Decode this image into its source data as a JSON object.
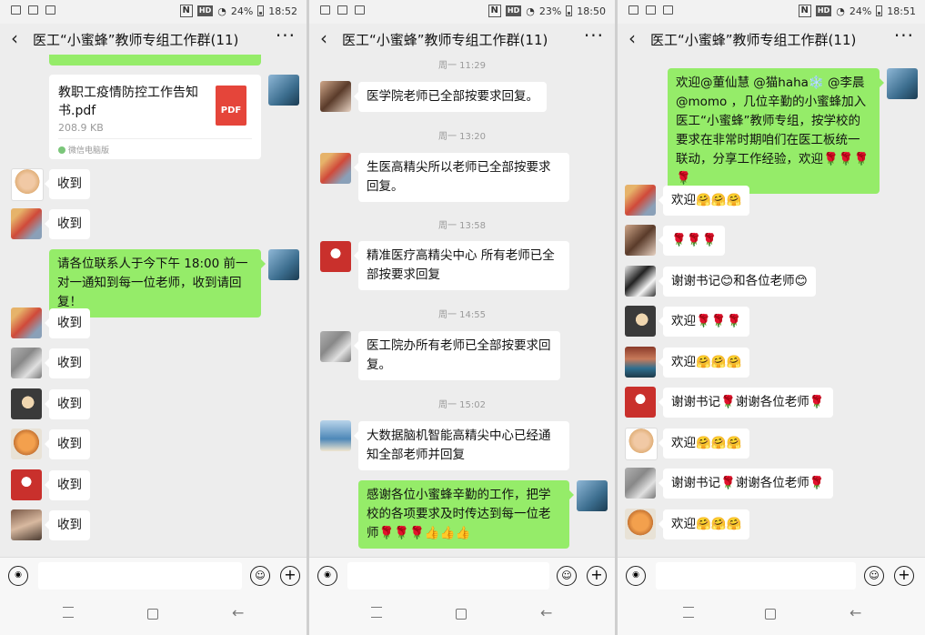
{
  "panels": [
    {
      "status": {
        "battery": "24%",
        "time": "18:52"
      },
      "title": "医工“小蜜蜂”教师专组工作群(11)",
      "file": {
        "name": "教职工疫情防控工作告知书.pdf",
        "size": "208.9 KB",
        "source": "微信电脑版",
        "icon_label": "PDF"
      },
      "messages": [
        {
          "text": "收到"
        },
        {
          "text": "收到"
        },
        {
          "text": "请各位联系人于今下午 18:00 前一对一通知到每一位老师，收到请回复！"
        },
        {
          "text": "收到"
        },
        {
          "text": "收到"
        },
        {
          "text": "收到"
        },
        {
          "text": "收到"
        },
        {
          "text": "收到"
        },
        {
          "text": "收到"
        }
      ]
    },
    {
      "status": {
        "battery": "23%",
        "time": "18:50"
      },
      "title": "医工“小蜜蜂”教师专组工作群(11)",
      "timestamps": [
        "周一 11:29",
        "周一 13:20",
        "周一 13:58",
        "周一 14:55",
        "周一 15:02"
      ],
      "messages": [
        {
          "text": "医学院老师已全部按要求回复。"
        },
        {
          "text": "生医高精尖所以老师已全部按要求回复。"
        },
        {
          "text": "精准医疗高精尖中心 所有老师已全部按要求回复"
        },
        {
          "text": "医工院办所有老师已全部按要求回复。"
        },
        {
          "text": "大数据脑机智能高精尖中心已经通知全部老师并回复"
        },
        {
          "text": "感谢各位小蜜蜂辛勤的工作，把学校的各项要求及时传达到每一位老师🌹🌹🌹👍👍👍"
        }
      ]
    },
    {
      "status": {
        "battery": "24%",
        "time": "18:51"
      },
      "title": "医工“小蜜蜂”教师专组工作群(11)",
      "messages": [
        {
          "text": "欢迎@董仙慧 @猫haha❄️ @李晨 @momo ，几位辛勤的小蜜蜂加入医工“小蜜蜂”教师专组，按学校的要求在非常时期咱们在医工板统一联动，分享工作经验，欢迎🌹🌹🌹🌹"
        },
        {
          "text": "欢迎🤗🤗🤗"
        },
        {
          "text": "🌹🌹🌹"
        },
        {
          "text": "谢谢书记😊和各位老师😊"
        },
        {
          "text": "欢迎🌹🌹🌹"
        },
        {
          "text": "欢迎🤗🤗🤗"
        },
        {
          "text": "谢谢书记🌹谢谢各位老师🌹"
        },
        {
          "text": "欢迎🤗🤗🤗"
        },
        {
          "text": "谢谢书记🌹谢谢各位老师🌹"
        },
        {
          "text": "欢迎🤗🤗🤗"
        }
      ]
    }
  ],
  "icons": {
    "back": "‹",
    "more": "···",
    "voice": "◉",
    "emoji": "☺",
    "plus": "+"
  }
}
